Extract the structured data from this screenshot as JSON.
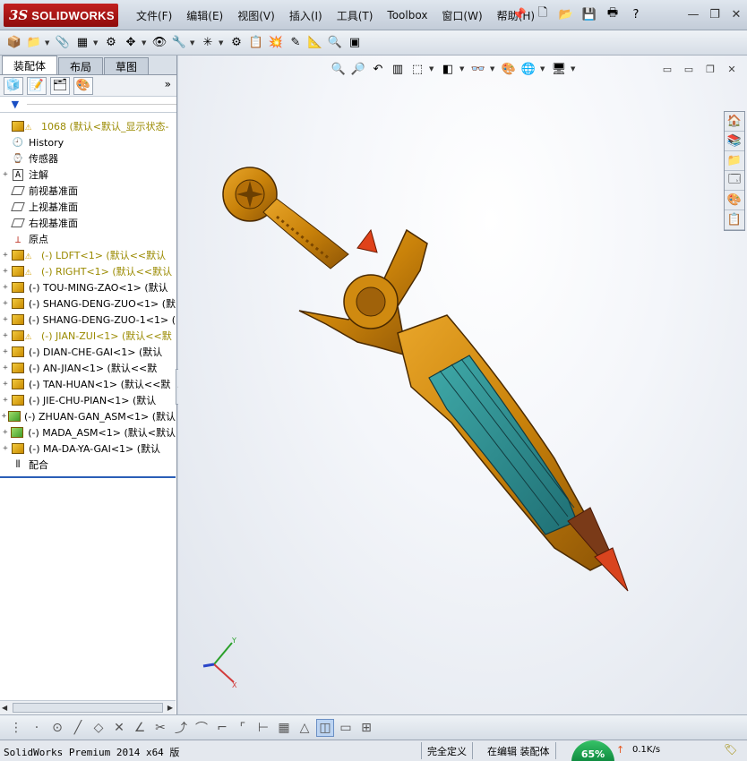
{
  "app": {
    "logo_prefix": "3S",
    "logo_name": "SOLIDWORKS"
  },
  "menu": [
    "文件(F)",
    "编辑(E)",
    "视图(V)",
    "插入(I)",
    "工具(T)",
    "Toolbox",
    "窗口(W)",
    "帮助(H)"
  ],
  "tabs": [
    "装配体",
    "布局",
    "草图"
  ],
  "tree": {
    "root": "1068  (默认<默认_显示状态-",
    "items": [
      {
        "label": "History",
        "icon": "history-icon"
      },
      {
        "label": "传感器",
        "icon": "sensor-icon"
      },
      {
        "label": "注解",
        "icon": "annotation-icon",
        "expand": "+"
      },
      {
        "label": "前视基准面",
        "icon": "plane-icon"
      },
      {
        "label": "上视基准面",
        "icon": "plane-icon"
      },
      {
        "label": "右视基准面",
        "icon": "plane-icon"
      },
      {
        "label": "原点",
        "icon": "origin-icon"
      },
      {
        "label": "(-) LDFT<1> (默认<<默认",
        "icon": "part-icon",
        "warn": true,
        "expand": "+"
      },
      {
        "label": "(-) RIGHT<1> (默认<<默认",
        "icon": "part-icon",
        "warn": true,
        "expand": "+"
      },
      {
        "label": "(-) TOU-MING-ZAO<1> (默认",
        "icon": "part-icon",
        "expand": "+"
      },
      {
        "label": "(-) SHANG-DENG-ZUO<1> (默",
        "icon": "part-icon",
        "expand": "+"
      },
      {
        "label": "(-) SHANG-DENG-ZUO-1<1> (",
        "icon": "part-icon",
        "expand": "+"
      },
      {
        "label": "(-) JIAN-ZUI<1> (默认<<默",
        "icon": "part-icon",
        "warn": true,
        "expand": "+"
      },
      {
        "label": "(-) DIAN-CHE-GAI<1> (默认",
        "icon": "part-icon",
        "expand": "+"
      },
      {
        "label": "(-) AN-JIAN<1> (默认<<默",
        "icon": "part-icon",
        "expand": "+"
      },
      {
        "label": "(-) TAN-HUAN<1> (默认<<默",
        "icon": "part-icon",
        "expand": "+"
      },
      {
        "label": "(-) JIE-CHU-PIAN<1> (默认",
        "icon": "part-icon",
        "expand": "+"
      },
      {
        "label": "(-) ZHUAN-GAN_ASM<1> (默认",
        "icon": "assembly-icon",
        "expand": "+"
      },
      {
        "label": "(-) MADA_ASM<1> (默认<默认",
        "icon": "assembly-icon",
        "expand": "+"
      },
      {
        "label": "(-) MA-DA-YA-GAI<1> (默认",
        "icon": "part-icon",
        "expand": "+"
      },
      {
        "label": "配合",
        "icon": "mates-icon"
      }
    ]
  },
  "status": {
    "product": "SolidWorks Premium 2014 x64 版",
    "definition": "完全定义",
    "mode": "在编辑 装配体",
    "badge": "65%",
    "net": "0.1K/s"
  },
  "colors": {
    "accent": "#2b5fb7",
    "warning": "#d4a000",
    "model_body": "#c9820a",
    "model_blade": "#2f8c8c"
  }
}
